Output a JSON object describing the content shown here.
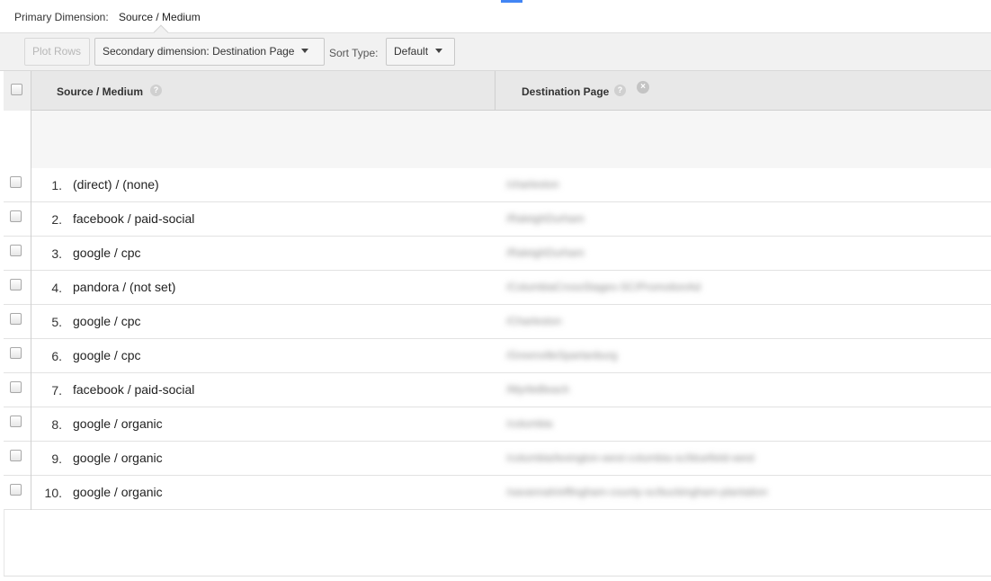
{
  "primary_dimension": {
    "label": "Primary Dimension:",
    "value": "Source / Medium"
  },
  "toolbar": {
    "plot_rows_label": "Plot Rows",
    "secondary_dimension_label": "Secondary dimension: Destination Page",
    "sort_type_label": "Sort Type:",
    "sort_type_value": "Default"
  },
  "table": {
    "columns": [
      {
        "label": "Source / Medium"
      },
      {
        "label": "Destination Page"
      }
    ],
    "help_glyph": "?",
    "remove_glyph": "×",
    "rows": [
      {
        "num": "1.",
        "source": "(direct) / (none)",
        "destination": "/charleston"
      },
      {
        "num": "2.",
        "source": "facebook / paid-social",
        "destination": "/RaleighDurham"
      },
      {
        "num": "3.",
        "source": "google / cpc",
        "destination": "/RaleighDurham"
      },
      {
        "num": "4.",
        "source": "pandora / (not set)",
        "destination": "/ColumbiaCrossStages-SC/PromotionAd"
      },
      {
        "num": "5.",
        "source": "google / cpc",
        "destination": "/Charleston"
      },
      {
        "num": "6.",
        "source": "google / cpc",
        "destination": "/GreenvilleSpartanburg"
      },
      {
        "num": "7.",
        "source": "facebook / paid-social",
        "destination": "/MyrtleBeach"
      },
      {
        "num": "8.",
        "source": "google / organic",
        "destination": "/columbia"
      },
      {
        "num": "9.",
        "source": "google / organic",
        "destination": "/columbia/lexington-west-columbia-sc/bluefield-west"
      },
      {
        "num": "10.",
        "source": "google / organic",
        "destination": "/savannah/effingham-county-sc/buckingham-plantation"
      }
    ]
  },
  "colors": {
    "accent": "#4285f4",
    "header_bg": "#e8e8e8",
    "toolbar_bg": "#f1f1f1"
  }
}
